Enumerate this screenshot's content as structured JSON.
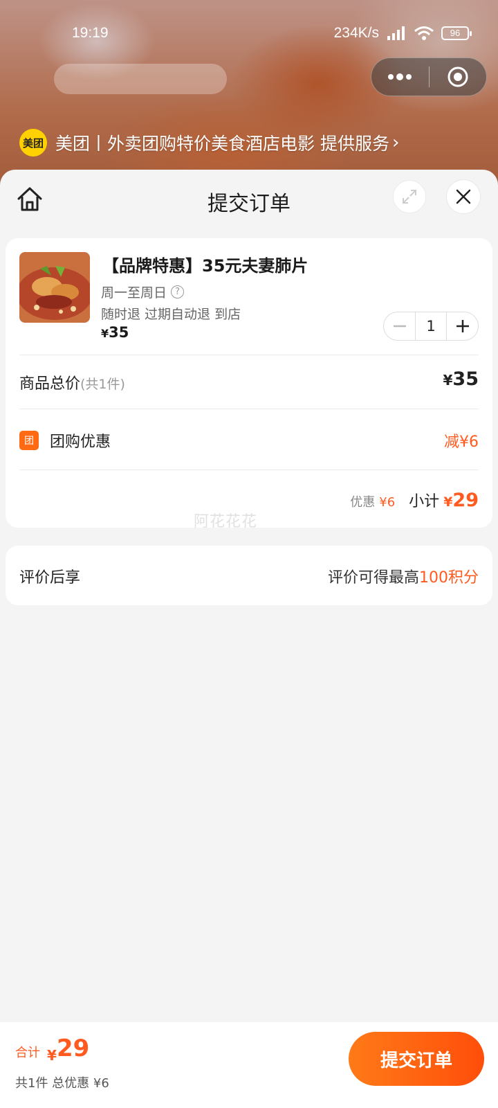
{
  "status_bar": {
    "time": "19:19",
    "network_speed": "234K/s",
    "battery": "96"
  },
  "banner": {
    "logo_text": "美团",
    "service_text": "美团丨外卖团购特价美食酒店电影 提供服务"
  },
  "header": {
    "title": "提交订单"
  },
  "product": {
    "title": "【品牌特惠】35元夫妻肺片",
    "days": "周一至周日",
    "policy": "随时退 过期自动退 到店",
    "price_currency": "¥",
    "price": "35",
    "quantity": "1"
  },
  "summary": {
    "total_label": "商品总价",
    "total_count": "(共1件)",
    "total_currency": "¥",
    "total_value": "35",
    "discount_badge": "团",
    "discount_label": "团购优惠",
    "discount_value": "减¥6",
    "saved_label": "优惠",
    "saved_value": "¥6",
    "subtotal_label": "小计",
    "subtotal_currency": "¥",
    "subtotal_value": "29"
  },
  "watermark": "阿花花花",
  "reward": {
    "label": "评价后享",
    "value_prefix": "评价可得最高",
    "value_highlight": "100积分"
  },
  "footer": {
    "total_label": "合计",
    "total_currency": "¥",
    "total_value": "29",
    "total_sub": "共1件 总优惠 ¥6",
    "submit_label": "提交订单"
  },
  "colors": {
    "accent": "#ff5a1f",
    "brand_yellow": "#ffd100",
    "button_gradient_start": "#ff7a18",
    "button_gradient_end": "#ff4e0a"
  }
}
